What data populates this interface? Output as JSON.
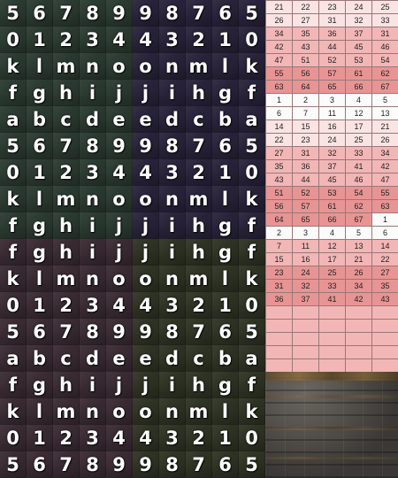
{
  "glyph_atlas": {
    "rows": [
      [
        "5",
        "6",
        "7",
        "8",
        "9",
        "9",
        "8",
        "7",
        "6",
        "5"
      ],
      [
        "0",
        "1",
        "2",
        "3",
        "4",
        "4",
        "3",
        "2",
        "1",
        "0"
      ],
      [
        "k",
        "l",
        "m",
        "n",
        "o",
        "o",
        "n",
        "m",
        "l",
        "k"
      ],
      [
        "f",
        "g",
        "h",
        "i",
        "j",
        "j",
        "i",
        "h",
        "g",
        "f"
      ],
      [
        "a",
        "b",
        "c",
        "d",
        "e",
        "e",
        "d",
        "c",
        "b",
        "a"
      ],
      [
        "5",
        "6",
        "7",
        "8",
        "9",
        "9",
        "8",
        "7",
        "6",
        "5"
      ],
      [
        "0",
        "1",
        "2",
        "3",
        "4",
        "4",
        "3",
        "2",
        "1",
        "0"
      ],
      [
        "k",
        "l",
        "m",
        "n",
        "o",
        "o",
        "n",
        "m",
        "l",
        "k"
      ],
      [
        "f",
        "g",
        "h",
        "i",
        "j",
        "j",
        "i",
        "h",
        "g",
        "f"
      ],
      [
        "f",
        "g",
        "h",
        "i",
        "j",
        "j",
        "i",
        "h",
        "g",
        "f"
      ],
      [
        "k",
        "l",
        "m",
        "n",
        "o",
        "o",
        "n",
        "m",
        "l",
        "k"
      ],
      [
        "0",
        "1",
        "2",
        "3",
        "4",
        "4",
        "3",
        "2",
        "1",
        "0"
      ],
      [
        "5",
        "6",
        "7",
        "8",
        "9",
        "9",
        "8",
        "7",
        "6",
        "5"
      ],
      [
        "a",
        "b",
        "c",
        "d",
        "e",
        "e",
        "d",
        "c",
        "b",
        "a"
      ],
      [
        "f",
        "g",
        "h",
        "i",
        "j",
        "j",
        "i",
        "h",
        "g",
        "f"
      ],
      [
        "k",
        "l",
        "m",
        "n",
        "o",
        "o",
        "n",
        "m",
        "l",
        "k"
      ],
      [
        "0",
        "1",
        "2",
        "3",
        "4",
        "4",
        "3",
        "2",
        "1",
        "0"
      ],
      [
        "5",
        "6",
        "7",
        "8",
        "9",
        "9",
        "8",
        "7",
        "6",
        "5"
      ]
    ],
    "colors": {
      "top_left": "#2b3a30",
      "top_right": "#28233a",
      "bottom_left": "#3a2b33",
      "bottom_right": "#2f3324"
    }
  },
  "number_sheet": {
    "rows": [
      [
        "21",
        "22",
        "23",
        "24",
        "25"
      ],
      [
        "26",
        "27",
        "31",
        "32",
        "33"
      ],
      [
        "34",
        "35",
        "36",
        "37",
        "31"
      ],
      [
        "42",
        "43",
        "44",
        "45",
        "46"
      ],
      [
        "47",
        "51",
        "52",
        "53",
        "54"
      ],
      [
        "55",
        "56",
        "57",
        "61",
        "62"
      ],
      [
        "63",
        "64",
        "65",
        "66",
        "67"
      ],
      [
        "1",
        "2",
        "3",
        "4",
        "5"
      ],
      [
        "6",
        "7",
        "11",
        "12",
        "13"
      ],
      [
        "14",
        "15",
        "16",
        "17",
        "21"
      ],
      [
        "22",
        "23",
        "24",
        "25",
        "26"
      ],
      [
        "27",
        "31",
        "32",
        "33",
        "34"
      ],
      [
        "35",
        "36",
        "37",
        "41",
        "42"
      ],
      [
        "43",
        "44",
        "45",
        "46",
        "47"
      ],
      [
        "51",
        "52",
        "53",
        "54",
        "55"
      ],
      [
        "56",
        "57",
        "61",
        "62",
        "63"
      ],
      [
        "64",
        "65",
        "66",
        "67",
        "1"
      ],
      [
        "2",
        "3",
        "4",
        "5",
        "6"
      ],
      [
        "7",
        "11",
        "12",
        "13",
        "14"
      ],
      [
        "15",
        "16",
        "17",
        "21",
        "22"
      ],
      [
        "23",
        "24",
        "25",
        "26",
        "27"
      ],
      [
        "31",
        "32",
        "33",
        "34",
        "35"
      ],
      [
        "36",
        "37",
        "41",
        "42",
        "43"
      ]
    ],
    "colors": {
      "light": "#f9e3e3",
      "mid": "#f2b6b6",
      "deep": "#e89494",
      "white": "#fbfbfb"
    }
  },
  "stone_texture": {
    "icon": "stone-floor-texture"
  }
}
